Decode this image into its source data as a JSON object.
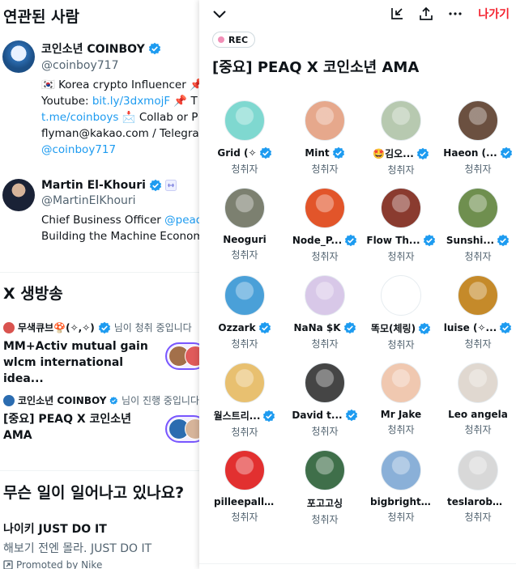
{
  "left": {
    "related_title": "연관된 사람",
    "people": [
      {
        "name": "코인소년 COINBOY",
        "handle": "@coinboy717",
        "verified": true,
        "bio_lines": [
          {
            "parts": [
              {
                "t": "🇰🇷 Korea crypto Influencer 📌",
                "link": false
              }
            ]
          },
          {
            "parts": [
              {
                "t": "Youtube: ",
                "link": false
              },
              {
                "t": "bit.ly/3dxmojF",
                "link": true
              },
              {
                "t": " 📌 T",
                "link": false
              }
            ]
          },
          {
            "parts": [
              {
                "t": "t.me/coinboys",
                "link": true
              },
              {
                "t": " 📩 Collab or P",
                "link": false
              }
            ]
          },
          {
            "parts": [
              {
                "t": "flyman@kakao.com / Telegra",
                "link": false
              }
            ]
          },
          {
            "parts": [
              {
                "t": "@coinboy717",
                "link": true
              }
            ]
          }
        ]
      },
      {
        "name": "Martin El-Khouri",
        "handle": "@MartinElKhouri",
        "verified": true,
        "bio_lines": [
          {
            "parts": [
              {
                "t": "Chief Business Officer ",
                "link": false
              },
              {
                "t": "@peaq",
                "link": true
              }
            ]
          },
          {
            "parts": [
              {
                "t": "Building the Machine Econom",
                "link": false
              }
            ]
          }
        ]
      }
    ],
    "live_title": "X 생방송",
    "lives": [
      {
        "host": "무색큐브🍄(✧,✧)",
        "suffix": "님이 청취 중입니다",
        "title": "MM+Activ mutual gain wlcm international idea..."
      },
      {
        "host": "코인소년 COINBOY",
        "suffix": "님이 진행 중입니다",
        "title": "[중요] PEAQ X 코인소년 AMA"
      }
    ],
    "happening_title": "무슨 일이 일어나고 있나요?",
    "trend": {
      "title": "나이키 JUST DO IT",
      "subtitle": "해보기 전엔 몰라. JUST DO IT",
      "promoted": "Promoted by Nike"
    }
  },
  "panel": {
    "leave_label": "나가기",
    "rec_label": "REC",
    "title": "[중요] PEAQ X 코인소년 AMA",
    "listeners": [
      {
        "name": "Grid (✧",
        "verified": true,
        "role": "청취자",
        "color": "#7fd8d0"
      },
      {
        "name": "Mint",
        "verified": true,
        "role": "청취자",
        "color": "#e6a88c"
      },
      {
        "name": "🤩김오...",
        "verified": true,
        "role": "청취자",
        "color": "#b7c9b0"
      },
      {
        "name": "Haeon (...",
        "verified": true,
        "role": "청취자",
        "color": "#6b5040"
      },
      {
        "name": "Neoguri",
        "verified": false,
        "role": "청취자",
        "color": "#7c8070"
      },
      {
        "name": "Node_P...",
        "verified": true,
        "role": "청취자",
        "color": "#e2552a"
      },
      {
        "name": "Flow Th...",
        "verified": true,
        "role": "청취자",
        "color": "#8a3b2f"
      },
      {
        "name": "Sunshi...",
        "verified": true,
        "role": "청취자",
        "color": "#6f8f4f"
      },
      {
        "name": "Ozzark",
        "verified": true,
        "role": "청취자",
        "color": "#4aa0d8"
      },
      {
        "name": "NaNa $K",
        "verified": true,
        "role": "청취자",
        "color": "#d8c8e8"
      },
      {
        "name": "똑모(체링)",
        "verified": true,
        "role": "청취자",
        "color": "#ffffff"
      },
      {
        "name": "luise (✧...",
        "verified": true,
        "role": "청취자",
        "color": "#c58a2a"
      },
      {
        "name": "월스트리...",
        "verified": true,
        "role": "청취자",
        "color": "#e8c070"
      },
      {
        "name": "David t...",
        "verified": true,
        "role": "청취자",
        "color": "#454545"
      },
      {
        "name": "Mr Jake",
        "verified": false,
        "role": "청취자",
        "color": "#f0c8b0"
      },
      {
        "name": "Leo angela",
        "verified": false,
        "role": "청취자",
        "color": "#e0d8d0"
      },
      {
        "name": "pilleepallee",
        "verified": false,
        "role": "청취자",
        "color": "#e23030"
      },
      {
        "name": "포고고싱",
        "verified": false,
        "role": "청취자",
        "color": "#3f6f4a"
      },
      {
        "name": "bigbright ...",
        "verified": false,
        "role": "청취자",
        "color": "#8ab0d8"
      },
      {
        "name": "teslarobot...",
        "verified": false,
        "role": "청취자",
        "color": "#d8d8d8"
      }
    ]
  },
  "colors": {
    "accent": "#1d9bf0",
    "leave": "#f4212e",
    "live": "#7856ff"
  },
  "icons": [
    "chevron-down-icon",
    "minimize-icon",
    "share-icon",
    "more-icon",
    "verified-icon",
    "affiliate-icon",
    "promoted-icon"
  ]
}
